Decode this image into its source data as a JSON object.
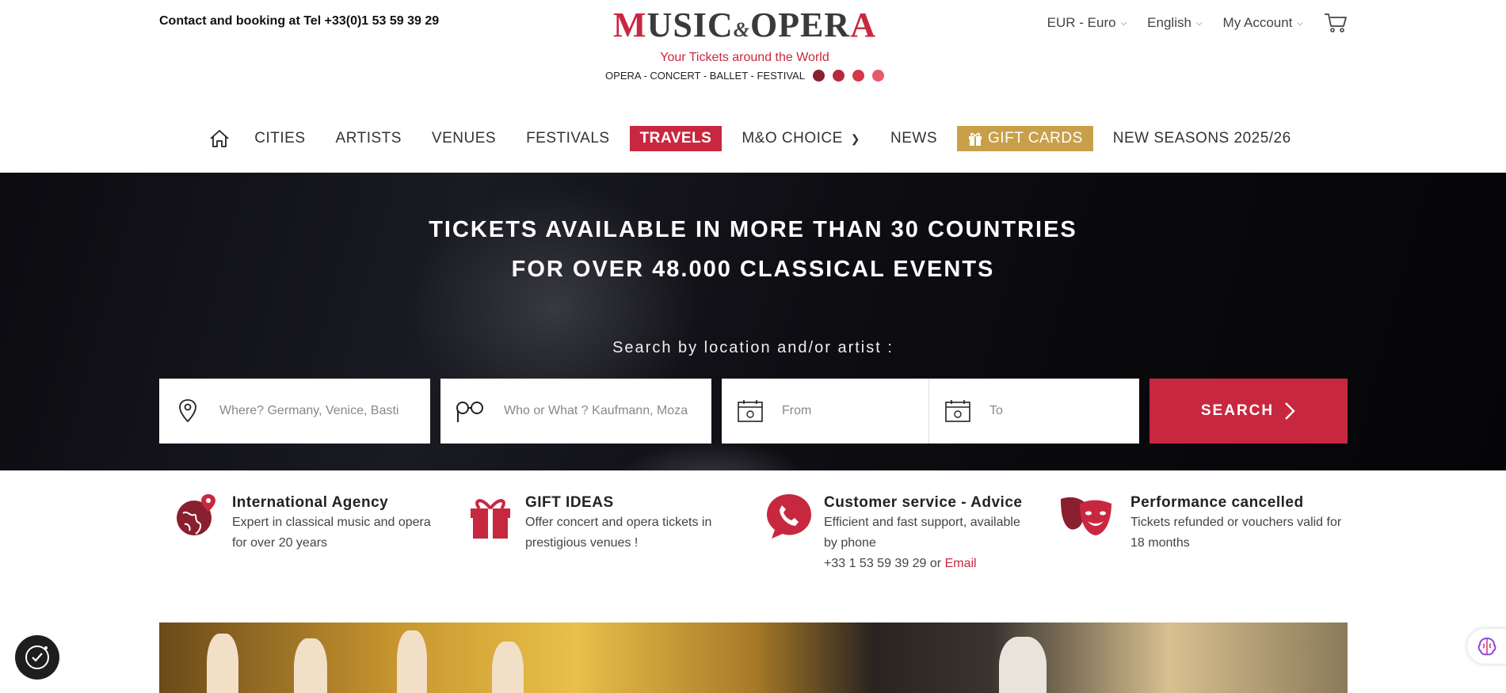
{
  "header": {
    "contact": "Contact and booking at Tel +33(0)1 53 59 39 29",
    "logo_title_left": "MUSIC",
    "logo_amp": "&",
    "logo_title_right": "OPERA",
    "logo_tagline": "Your Tickets around the World",
    "logo_categories": "OPERA - CONCERT - BALLET - FESTIVAL",
    "logo_dot_colors": [
      "#8a1f2e",
      "#b8283c",
      "#d63849",
      "#e85a6a"
    ],
    "currency": "EUR - Euro",
    "language": "English",
    "account": "My Account"
  },
  "nav": {
    "items": [
      "CITIES",
      "ARTISTS",
      "VENUES",
      "FESTIVALS",
      "TRAVELS",
      "M&O CHOICE",
      "NEWS",
      "GIFT CARDS",
      "NEW SEASONS 2025/26"
    ]
  },
  "hero": {
    "line1": "TICKETS AVAILABLE IN MORE THAN 30 COUNTRIES",
    "line2": "FOR OVER 48.000 CLASSICAL EVENTS",
    "search_label": "Search by location and/or artist :",
    "where_placeholder": "Where? Germany, Venice, Basti",
    "who_placeholder": "Who or What ? Kaufmann, Moza",
    "from_placeholder": "From",
    "to_placeholder": "To",
    "search_button": "SEARCH"
  },
  "features": [
    {
      "title": "International Agency",
      "text": "Expert in classical music and opera for over 20 years"
    },
    {
      "title": "GIFT IDEAS",
      "text": "Offer concert and opera tickets in prestigious venues !"
    },
    {
      "title": "Customer service - Advice",
      "text": "Efficient and fast support, available by phone",
      "phone": "+33 1 53 59 39 29 or ",
      "email": "Email"
    },
    {
      "title": "Performance cancelled",
      "text": "Tickets refunded or vouchers valid for 18 months"
    }
  ],
  "colors": {
    "brand_red": "#c8283f",
    "gold": "#c9a04a",
    "dark_red": "#8a1f2e"
  }
}
